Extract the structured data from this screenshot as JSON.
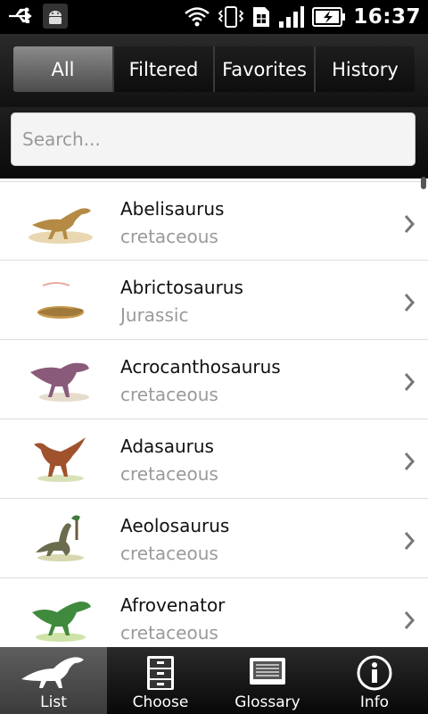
{
  "status_bar": {
    "time": "16:37",
    "icons": [
      "usb-icon",
      "android-debug-icon",
      "wifi-icon",
      "vibrate-icon",
      "sim-icon",
      "signal-icon",
      "battery-charging-icon"
    ]
  },
  "tabs": [
    {
      "label": "All",
      "active": true
    },
    {
      "label": "Filtered",
      "active": false
    },
    {
      "label": "Favorites",
      "active": false
    },
    {
      "label": "History",
      "active": false
    }
  ],
  "search": {
    "placeholder": "Search...",
    "value": ""
  },
  "list": [
    {
      "name": "Abelisaurus",
      "period": "cretaceous",
      "color": "#b58a44"
    },
    {
      "name": "Abrictosaurus",
      "period": "Jurassic",
      "color": "#c99a4b"
    },
    {
      "name": "Acrocanthosaurus",
      "period": "cretaceous",
      "color": "#8a5a7a"
    },
    {
      "name": "Adasaurus",
      "period": "cretaceous",
      "color": "#a0522d"
    },
    {
      "name": "Aeolosaurus",
      "period": "cretaceous",
      "color": "#6b6b4e"
    },
    {
      "name": "Afrovenator",
      "period": "cretaceous",
      "color": "#3f8a3c"
    }
  ],
  "bottom_nav": [
    {
      "label": "List",
      "icon": "dinosaur-icon",
      "active": true
    },
    {
      "label": "Choose",
      "icon": "cabinet-icon",
      "active": false
    },
    {
      "label": "Glossary",
      "icon": "book-icon",
      "active": false
    },
    {
      "label": "Info",
      "icon": "info-icon",
      "active": false
    }
  ]
}
